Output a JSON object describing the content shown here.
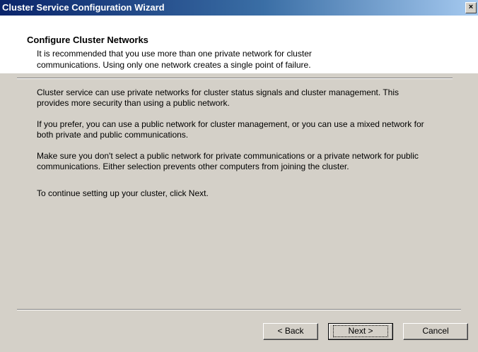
{
  "window": {
    "title": "Cluster Service Configuration Wizard",
    "close_label": "×"
  },
  "header": {
    "title": "Configure Cluster Networks",
    "subtitle": "It is recommended that you use more than one private network for cluster communications. Using only one network creates a single point of failure."
  },
  "body": {
    "paragraphs": [
      "Cluster service can use private networks for cluster status signals and cluster management. This provides more security than using a public network.",
      "If you prefer, you can use a  public network for cluster management, or you can use a mixed network for both private and public communications.",
      "Make sure you don't select a public network for private communications or a private network for public communications. Either selection prevents other computers from joining the cluster.",
      "To continue setting up your cluster, click Next."
    ]
  },
  "buttons": {
    "back": "< Back",
    "next": "Next >",
    "cancel": "Cancel"
  }
}
